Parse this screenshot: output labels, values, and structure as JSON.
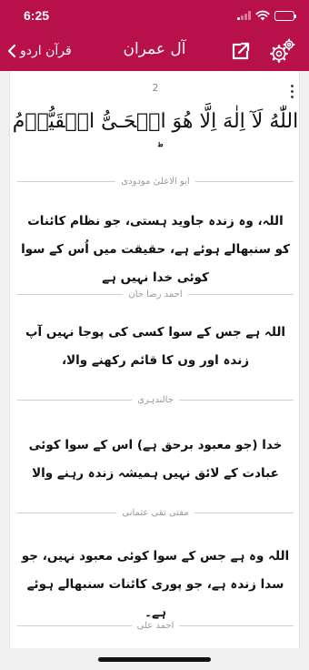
{
  "status_bar": {
    "time": "6:25",
    "battery_level": 1.0
  },
  "nav": {
    "back_label": "قرآن اردو",
    "title": "آل عمران",
    "share_icon": "share-external-icon",
    "settings_icon": "gear-icon",
    "color": "#b8104a"
  },
  "verse": {
    "number": "2",
    "arabic": "اللّٰهُ لَآ اِلٰهَ اِلَّا هُوَ الۡحَـىُّ الۡقَيُّوۡمُ ؕ"
  },
  "translations": [
    {
      "translator": "ابو الاعلیٰ مودودی",
      "text": "اللہ، وہ زندہ جاوید ہستی، جو نظام کائنات کو سنبھالے ہوئے ہے، حقیقت میں اُس کے سوا کوئی خدا نہیں ہے"
    },
    {
      "translator": "احمد رضا خان",
      "text": "اللہ ہے جس کے سوا کسی کی پوجا نہیں آپ زندہ اور وں کا قائم رکھنے والا،"
    },
    {
      "translator": "جالندہری",
      "text": "خدا (جو معبود برحق ہے) اس کے سوا کوئی عبادت کے لائق نہیں ہمیشہ زندہ رہنے والا"
    },
    {
      "translator": "مفتی تقی عثمانی",
      "text": "اللہ وہ ہے جس کے سوا کوئی معبود نہیں، جو سدا زندہ ہے، جو پوری کائنات سنبھالے ہوئے ہے۔"
    },
    {
      "translator": "احمد علی",
      "text": ""
    }
  ]
}
